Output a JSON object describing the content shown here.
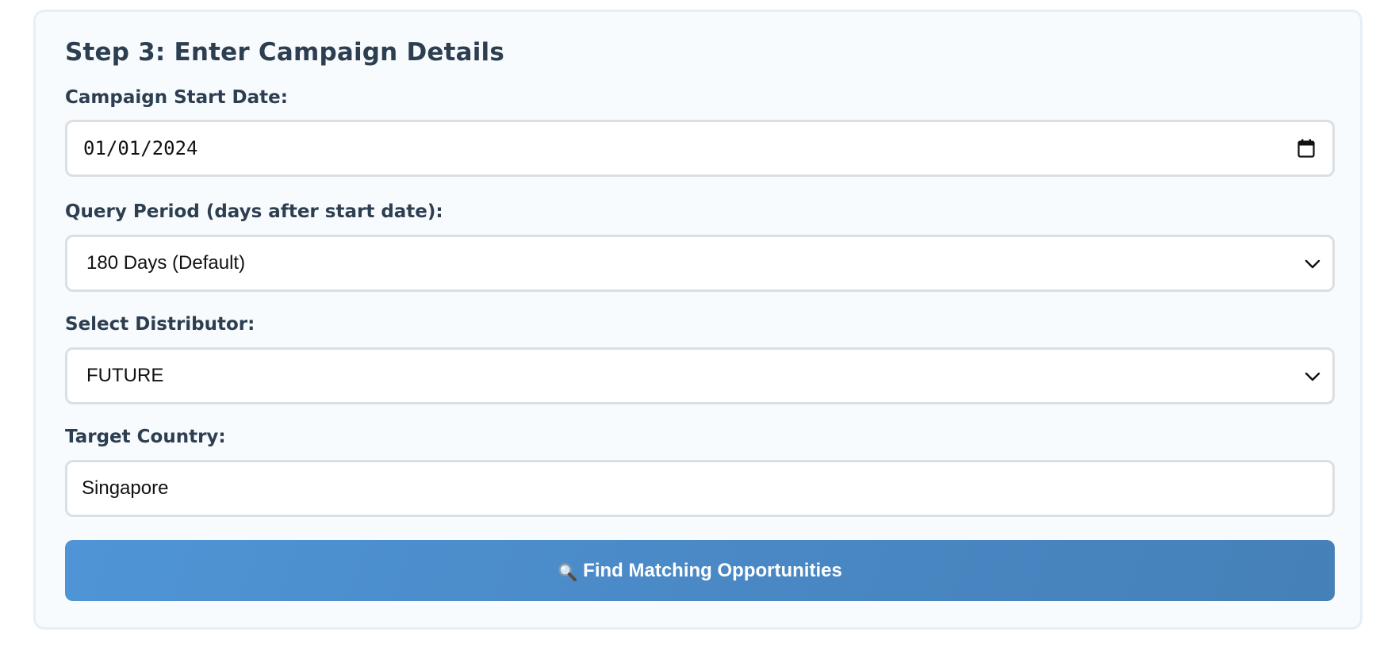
{
  "step": {
    "title": "Step 3: Enter Campaign Details"
  },
  "fields": {
    "start_date": {
      "label": "Campaign Start Date:",
      "value": "01/01/2024",
      "icon": "calendar-icon"
    },
    "query_period": {
      "label": "Query Period (days after start date):",
      "selected": "180 Days (Default)",
      "icon": "chevron-down-icon"
    },
    "distributor": {
      "label": "Select Distributor:",
      "selected": "FUTURE",
      "icon": "chevron-down-icon"
    },
    "country": {
      "label": "Target Country:",
      "value": "Singapore"
    }
  },
  "actions": {
    "find_label": "Find Matching Opportunities",
    "find_icon": "search-icon"
  },
  "colors": {
    "card_background": "#f7fbfe",
    "heading_text": "#2c3e50",
    "button_gradient_start": "#4f95d6",
    "button_gradient_end": "#4580b8",
    "button_text": "#ffffff"
  }
}
